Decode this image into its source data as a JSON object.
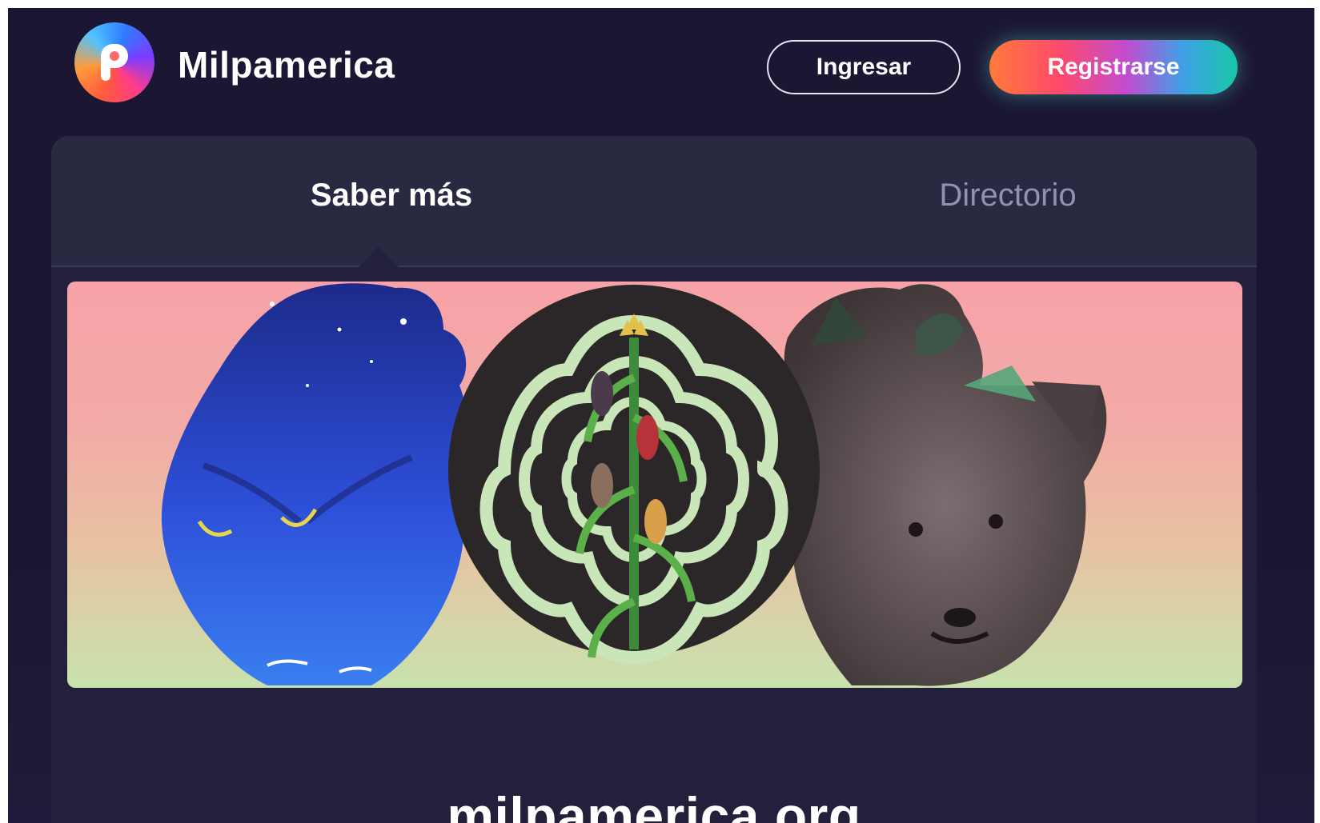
{
  "header": {
    "brand": "Milpamerica",
    "login_label": "Ingresar",
    "register_label": "Registrarse"
  },
  "tabs": [
    {
      "label": "Saber más",
      "active": true
    },
    {
      "label": "Directorio",
      "active": false
    }
  ],
  "banner": {
    "illustrations": [
      "blue-heart-owl",
      "corn-medallion",
      "wolf-heart"
    ]
  },
  "footer": {
    "domain": "milpamerica.org"
  },
  "colors": {
    "background": "#1b1633",
    "card": "#22203a",
    "tabbar": "#2a2942",
    "inactive_tab": "#8d93b0",
    "register_gradient": [
      "#ff7a3a",
      "#ff4a6a",
      "#c34bd0",
      "#3fa0e6",
      "#18c8a8"
    ]
  }
}
